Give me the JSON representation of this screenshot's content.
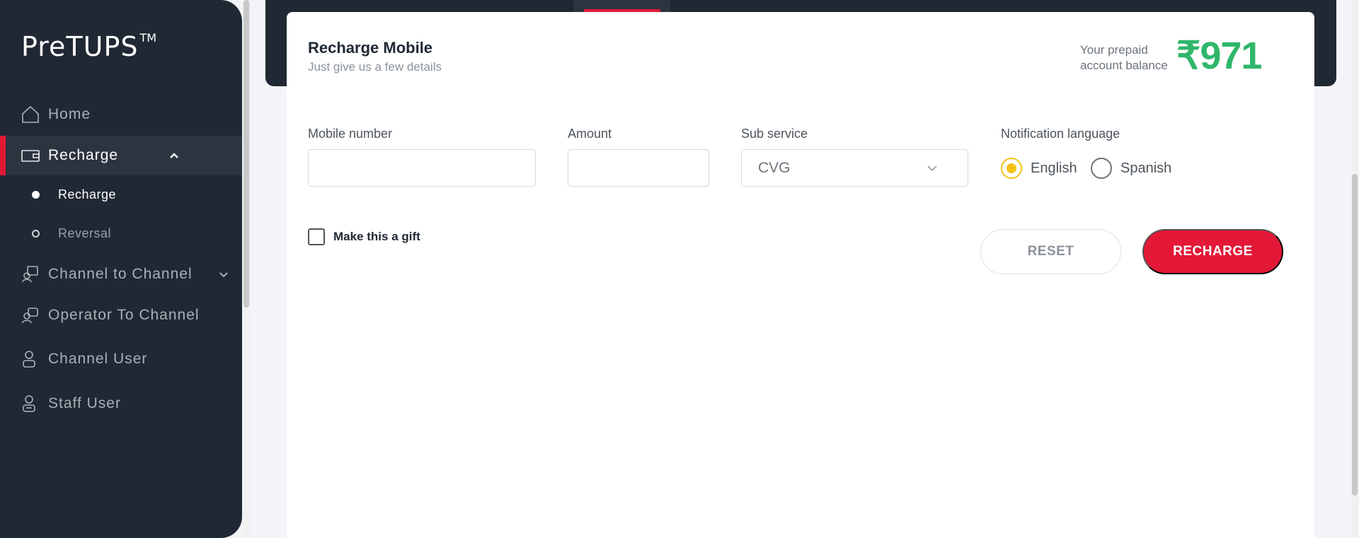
{
  "app": {
    "logo": "PreTUPS",
    "logo_tm": "TM"
  },
  "sidebar": {
    "items": [
      {
        "label": "Home",
        "icon": "home-icon"
      },
      {
        "label": "Recharge",
        "icon": "wallet-icon",
        "expanded": true
      },
      {
        "label": "Channel to Channel",
        "icon": "channel-transfer-icon"
      },
      {
        "label": "Operator To Channel",
        "icon": "operator-transfer-icon"
      },
      {
        "label": "Channel User",
        "icon": "user-icon"
      },
      {
        "label": "Staff User",
        "icon": "staff-user-icon"
      }
    ],
    "recharge_sub": [
      {
        "label": "Recharge",
        "selected": true
      },
      {
        "label": "Reversal",
        "selected": false
      }
    ]
  },
  "card": {
    "title": "Recharge Mobile",
    "subtitle": "Just give us a few details",
    "balance_label": "Your prepaid account balance",
    "balance_value": "₹971"
  },
  "form": {
    "mobile_label": "Mobile number",
    "mobile_value": "",
    "amount_label": "Amount",
    "amount_value": "",
    "subservice_label": "Sub service",
    "subservice_value": "CVG",
    "language_label": "Notification language",
    "languages": [
      {
        "label": "English",
        "selected": true
      },
      {
        "label": "Spanish",
        "selected": false
      }
    ],
    "gift_label": "Make this a gift",
    "gift_checked": false,
    "reset_label": "RESET",
    "submit_label": "RECHARGE"
  },
  "colors": {
    "brand_red": "#e31837",
    "balance_green": "#2fb66a",
    "radio_yellow": "#f2c418",
    "sidebar_bg": "#1f2833"
  }
}
